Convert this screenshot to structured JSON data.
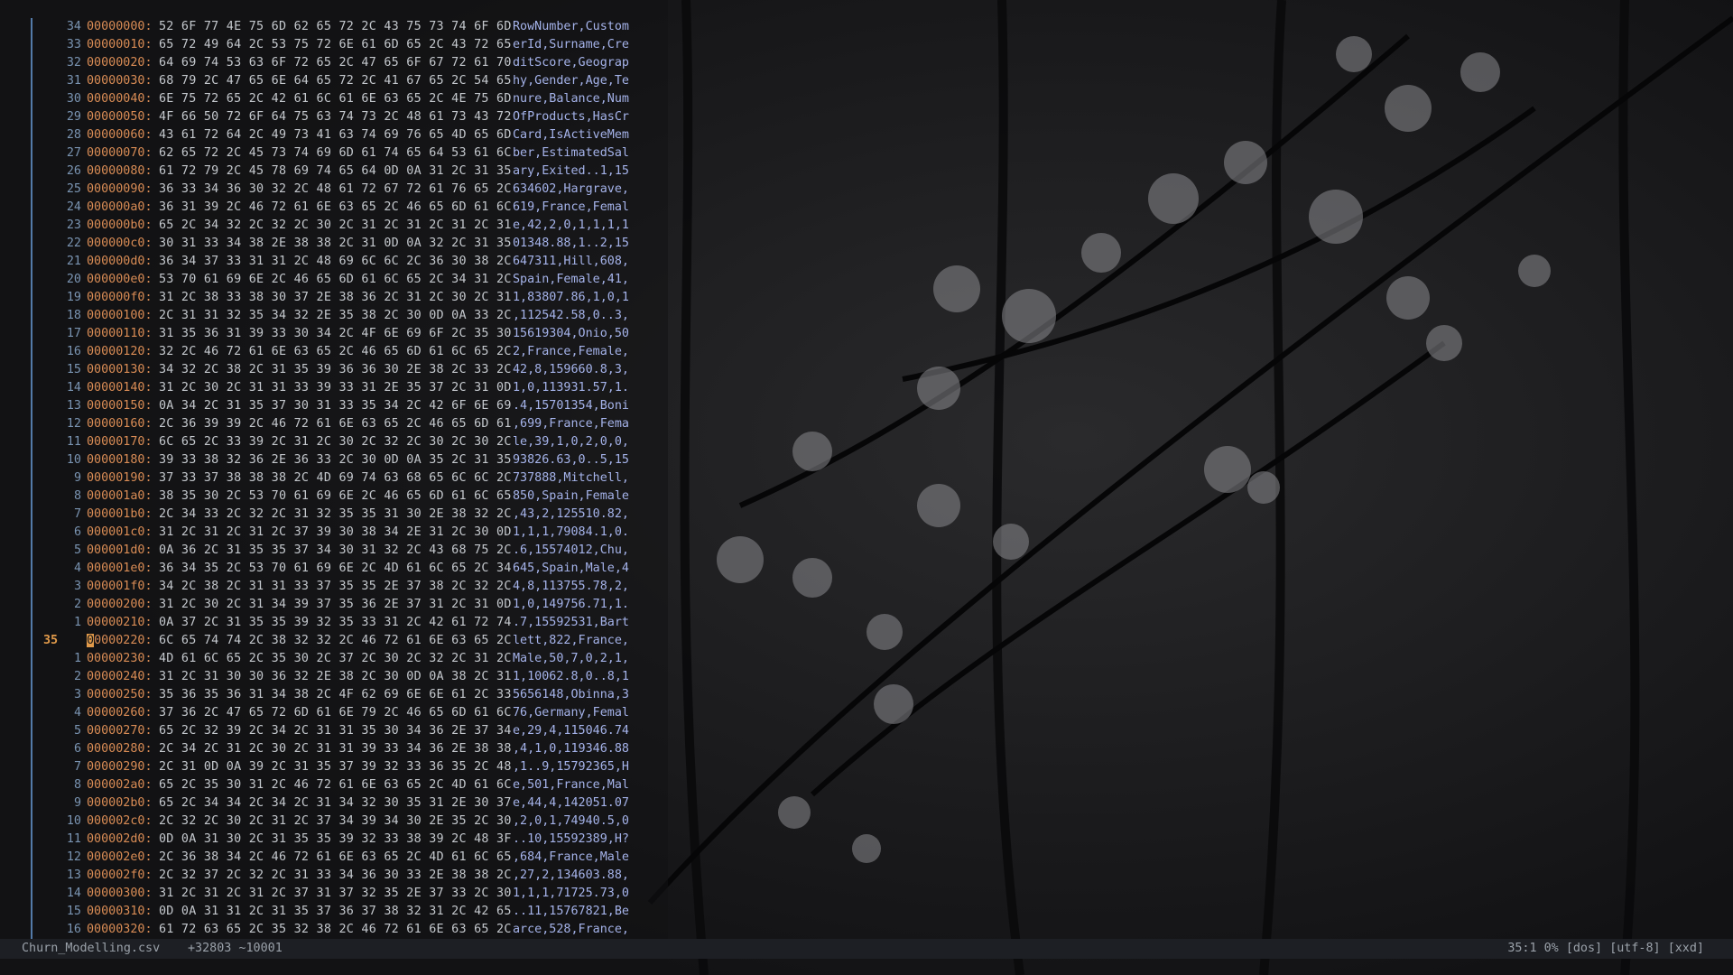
{
  "window": {
    "title": "Churn_Modelling.csv"
  },
  "editor": {
    "current_line_number": "35",
    "rows": [
      {
        "ln": "34",
        "addr": "00000000:",
        "hex": "52 6F 77 4E 75 6D 62 65 72 2C 43 75 73 74 6F 6D",
        "ascii": "RowNumber,Custom"
      },
      {
        "ln": "33",
        "addr": "00000010:",
        "hex": "65 72 49 64 2C 53 75 72 6E 61 6D 65 2C 43 72 65",
        "ascii": "erId,Surname,Cre"
      },
      {
        "ln": "32",
        "addr": "00000020:",
        "hex": "64 69 74 53 63 6F 72 65 2C 47 65 6F 67 72 61 70",
        "ascii": "ditScore,Geograp"
      },
      {
        "ln": "31",
        "addr": "00000030:",
        "hex": "68 79 2C 47 65 6E 64 65 72 2C 41 67 65 2C 54 65",
        "ascii": "hy,Gender,Age,Te"
      },
      {
        "ln": "30",
        "addr": "00000040:",
        "hex": "6E 75 72 65 2C 42 61 6C 61 6E 63 65 2C 4E 75 6D",
        "ascii": "nure,Balance,Num"
      },
      {
        "ln": "29",
        "addr": "00000050:",
        "hex": "4F 66 50 72 6F 64 75 63 74 73 2C 48 61 73 43 72",
        "ascii": "OfProducts,HasCr"
      },
      {
        "ln": "28",
        "addr": "00000060:",
        "hex": "43 61 72 64 2C 49 73 41 63 74 69 76 65 4D 65 6D",
        "ascii": "Card,IsActiveMem"
      },
      {
        "ln": "27",
        "addr": "00000070:",
        "hex": "62 65 72 2C 45 73 74 69 6D 61 74 65 64 53 61 6C",
        "ascii": "ber,EstimatedSal"
      },
      {
        "ln": "26",
        "addr": "00000080:",
        "hex": "61 72 79 2C 45 78 69 74 65 64 0D 0A 31 2C 31 35",
        "ascii": "ary,Exited..1,15"
      },
      {
        "ln": "25",
        "addr": "00000090:",
        "hex": "36 33 34 36 30 32 2C 48 61 72 67 72 61 76 65 2C",
        "ascii": "634602,Hargrave,"
      },
      {
        "ln": "24",
        "addr": "000000a0:",
        "hex": "36 31 39 2C 46 72 61 6E 63 65 2C 46 65 6D 61 6C",
        "ascii": "619,France,Femal"
      },
      {
        "ln": "23",
        "addr": "000000b0:",
        "hex": "65 2C 34 32 2C 32 2C 30 2C 31 2C 31 2C 31 2C 31",
        "ascii": "e,42,2,0,1,1,1,1"
      },
      {
        "ln": "22",
        "addr": "000000c0:",
        "hex": "30 31 33 34 38 2E 38 38 2C 31 0D 0A 32 2C 31 35",
        "ascii": "01348.88,1..2,15"
      },
      {
        "ln": "21",
        "addr": "000000d0:",
        "hex": "36 34 37 33 31 31 2C 48 69 6C 6C 2C 36 30 38 2C",
        "ascii": "647311,Hill,608,"
      },
      {
        "ln": "20",
        "addr": "000000e0:",
        "hex": "53 70 61 69 6E 2C 46 65 6D 61 6C 65 2C 34 31 2C",
        "ascii": "Spain,Female,41,"
      },
      {
        "ln": "19",
        "addr": "000000f0:",
        "hex": "31 2C 38 33 38 30 37 2E 38 36 2C 31 2C 30 2C 31",
        "ascii": "1,83807.86,1,0,1"
      },
      {
        "ln": "18",
        "addr": "00000100:",
        "hex": "2C 31 31 32 35 34 32 2E 35 38 2C 30 0D 0A 33 2C",
        "ascii": ",112542.58,0..3,"
      },
      {
        "ln": "17",
        "addr": "00000110:",
        "hex": "31 35 36 31 39 33 30 34 2C 4F 6E 69 6F 2C 35 30",
        "ascii": "15619304,Onio,50"
      },
      {
        "ln": "16",
        "addr": "00000120:",
        "hex": "32 2C 46 72 61 6E 63 65 2C 46 65 6D 61 6C 65 2C",
        "ascii": "2,France,Female,"
      },
      {
        "ln": "15",
        "addr": "00000130:",
        "hex": "34 32 2C 38 2C 31 35 39 36 36 30 2E 38 2C 33 2C",
        "ascii": "42,8,159660.8,3,"
      },
      {
        "ln": "14",
        "addr": "00000140:",
        "hex": "31 2C 30 2C 31 31 33 39 33 31 2E 35 37 2C 31 0D",
        "ascii": "1,0,113931.57,1."
      },
      {
        "ln": "13",
        "addr": "00000150:",
        "hex": "0A 34 2C 31 35 37 30 31 33 35 34 2C 42 6F 6E 69",
        "ascii": ".4,15701354,Boni"
      },
      {
        "ln": "12",
        "addr": "00000160:",
        "hex": "2C 36 39 39 2C 46 72 61 6E 63 65 2C 46 65 6D 61",
        "ascii": ",699,France,Fema"
      },
      {
        "ln": "11",
        "addr": "00000170:",
        "hex": "6C 65 2C 33 39 2C 31 2C 30 2C 32 2C 30 2C 30 2C",
        "ascii": "le,39,1,0,2,0,0,"
      },
      {
        "ln": "10",
        "addr": "00000180:",
        "hex": "39 33 38 32 36 2E 36 33 2C 30 0D 0A 35 2C 31 35",
        "ascii": "93826.63,0..5,15"
      },
      {
        "ln": "9",
        "addr": "00000190:",
        "hex": "37 33 37 38 38 38 2C 4D 69 74 63 68 65 6C 6C 2C",
        "ascii": "737888,Mitchell,"
      },
      {
        "ln": "8",
        "addr": "000001a0:",
        "hex": "38 35 30 2C 53 70 61 69 6E 2C 46 65 6D 61 6C 65",
        "ascii": "850,Spain,Female"
      },
      {
        "ln": "7",
        "addr": "000001b0:",
        "hex": "2C 34 33 2C 32 2C 31 32 35 35 31 30 2E 38 32 2C",
        "ascii": ",43,2,125510.82,"
      },
      {
        "ln": "6",
        "addr": "000001c0:",
        "hex": "31 2C 31 2C 31 2C 37 39 30 38 34 2E 31 2C 30 0D",
        "ascii": "1,1,1,79084.1,0."
      },
      {
        "ln": "5",
        "addr": "000001d0:",
        "hex": "0A 36 2C 31 35 35 37 34 30 31 32 2C 43 68 75 2C",
        "ascii": ".6,15574012,Chu,"
      },
      {
        "ln": "4",
        "addr": "000001e0:",
        "hex": "36 34 35 2C 53 70 61 69 6E 2C 4D 61 6C 65 2C 34",
        "ascii": "645,Spain,Male,4"
      },
      {
        "ln": "3",
        "addr": "000001f0:",
        "hex": "34 2C 38 2C 31 31 33 37 35 35 2E 37 38 2C 32 2C",
        "ascii": "4,8,113755.78,2,"
      },
      {
        "ln": "2",
        "addr": "00000200:",
        "hex": "31 2C 30 2C 31 34 39 37 35 36 2E 37 31 2C 31 0D",
        "ascii": "1,0,149756.71,1."
      },
      {
        "ln": "1",
        "addr": "00000210:",
        "hex": "0A 37 2C 31 35 35 39 32 35 33 31 2C 42 61 72 74",
        "ascii": ".7,15592531,Bart"
      },
      {
        "ln": "35",
        "addr": "00000220:",
        "hex": "6C 65 74 74 2C 38 32 32 2C 46 72 61 6E 63 65 2C",
        "ascii": "lett,822,France,",
        "current": true
      },
      {
        "ln": "1",
        "addr": "00000230:",
        "hex": "4D 61 6C 65 2C 35 30 2C 37 2C 30 2C 32 2C 31 2C",
        "ascii": "Male,50,7,0,2,1,"
      },
      {
        "ln": "2",
        "addr": "00000240:",
        "hex": "31 2C 31 30 30 36 32 2E 38 2C 30 0D 0A 38 2C 31",
        "ascii": "1,10062.8,0..8,1"
      },
      {
        "ln": "3",
        "addr": "00000250:",
        "hex": "35 36 35 36 31 34 38 2C 4F 62 69 6E 6E 61 2C 33",
        "ascii": "5656148,Obinna,3"
      },
      {
        "ln": "4",
        "addr": "00000260:",
        "hex": "37 36 2C 47 65 72 6D 61 6E 79 2C 46 65 6D 61 6C",
        "ascii": "76,Germany,Femal"
      },
      {
        "ln": "5",
        "addr": "00000270:",
        "hex": "65 2C 32 39 2C 34 2C 31 31 35 30 34 36 2E 37 34",
        "ascii": "e,29,4,115046.74"
      },
      {
        "ln": "6",
        "addr": "00000280:",
        "hex": "2C 34 2C 31 2C 30 2C 31 31 39 33 34 36 2E 38 38",
        "ascii": ",4,1,0,119346.88"
      },
      {
        "ln": "7",
        "addr": "00000290:",
        "hex": "2C 31 0D 0A 39 2C 31 35 37 39 32 33 36 35 2C 48",
        "ascii": ",1..9,15792365,H"
      },
      {
        "ln": "8",
        "addr": "000002a0:",
        "hex": "65 2C 35 30 31 2C 46 72 61 6E 63 65 2C 4D 61 6C",
        "ascii": "e,501,France,Mal"
      },
      {
        "ln": "9",
        "addr": "000002b0:",
        "hex": "65 2C 34 34 2C 34 2C 31 34 32 30 35 31 2E 30 37",
        "ascii": "e,44,4,142051.07"
      },
      {
        "ln": "10",
        "addr": "000002c0:",
        "hex": "2C 32 2C 30 2C 31 2C 37 34 39 34 30 2E 35 2C 30",
        "ascii": ",2,0,1,74940.5,0"
      },
      {
        "ln": "11",
        "addr": "000002d0:",
        "hex": "0D 0A 31 30 2C 31 35 35 39 32 33 38 39 2C 48 3F",
        "ascii": "..10,15592389,H?"
      },
      {
        "ln": "12",
        "addr": "000002e0:",
        "hex": "2C 36 38 34 2C 46 72 61 6E 63 65 2C 4D 61 6C 65",
        "ascii": ",684,France,Male"
      },
      {
        "ln": "13",
        "addr": "000002f0:",
        "hex": "2C 32 37 2C 32 2C 31 33 34 36 30 33 2E 38 38 2C",
        "ascii": ",27,2,134603.88,"
      },
      {
        "ln": "14",
        "addr": "00000300:",
        "hex": "31 2C 31 2C 31 2C 37 31 37 32 35 2E 37 33 2C 30",
        "ascii": "1,1,1,71725.73,0"
      },
      {
        "ln": "15",
        "addr": "00000310:",
        "hex": "0D 0A 31 31 2C 31 35 37 36 37 38 32 31 2C 42 65",
        "ascii": "..11,15767821,Be"
      },
      {
        "ln": "16",
        "addr": "00000320:",
        "hex": "61 72 63 65 2C 35 32 38 2C 46 72 61 6E 63 65 2C",
        "ascii": "arce,528,France,"
      }
    ]
  },
  "statusbar": {
    "filename": "Churn_Modelling.csv",
    "info": "+32803 ~10001",
    "position": "35:1",
    "percent": "0%",
    "format": "[dos]",
    "encoding": "[utf-8]",
    "filetype": "[xxd]"
  },
  "colors": {
    "background": "#141416",
    "address": "#d98c55",
    "hex": "#c4c8cd",
    "ascii": "#a5b3ea",
    "line_number": "#7a94b2",
    "current_line_number": "#e19a4a"
  }
}
